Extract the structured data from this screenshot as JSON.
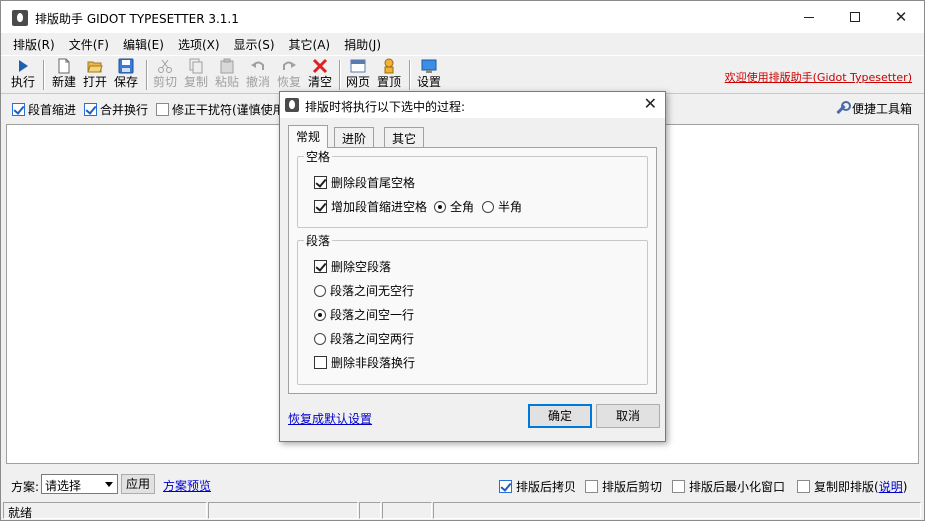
{
  "window": {
    "title": "排版助手 GIDOT TYPESETTER 3.1.1"
  },
  "menu": [
    "排版(R)",
    "文件(F)",
    "编辑(E)",
    "选项(X)",
    "显示(S)",
    "其它(A)",
    "捐助(J)"
  ],
  "toolbar": {
    "run": "执行",
    "new": "新建",
    "open": "打开",
    "save": "保存",
    "cut": "剪切",
    "copy": "复制",
    "paste": "粘贴",
    "undo": "撤消",
    "redo": "恢复",
    "clear": "清空",
    "web": "网页",
    "top": "置顶",
    "settings": "设置",
    "welcome": "欢迎使用排版助手(Gidot Typesetter)"
  },
  "options": {
    "indent": {
      "label": "段首缩进",
      "checked": true
    },
    "merge_lines": {
      "label": "合并换行",
      "checked": true
    },
    "fix_interference": {
      "label": "修正干扰符(谨慎使用",
      "checked": false
    },
    "toolbox": "便捷工具箱"
  },
  "bottom": {
    "scheme_label": "方案:",
    "scheme_value": "请选择",
    "apply": "应用",
    "preview": "方案预览",
    "copy_after": {
      "label": "排版后拷贝",
      "checked": true
    },
    "cut_after": {
      "label": "排版后剪切",
      "checked": false
    },
    "minimize_after": {
      "label": "排版后最小化窗口",
      "checked": false
    },
    "copy_to_typeset": {
      "label": "复制即排版(",
      "checked": false
    },
    "explain": "说明",
    "paren_close": ")"
  },
  "status": {
    "text": "就绪"
  },
  "dialog": {
    "title": "排版时将执行以下选中的过程:",
    "tabs": [
      "常规",
      "进阶",
      "其它"
    ],
    "group_space": {
      "label": "空格",
      "remove_trailing": {
        "label": "删除段首尾空格",
        "checked": true
      },
      "add_indent": {
        "label": "增加段首缩进空格",
        "checked": true
      },
      "full_width": {
        "label": "全角",
        "checked": true
      },
      "half_width": {
        "label": "半角",
        "checked": false
      }
    },
    "group_paragraph": {
      "label": "段落",
      "remove_empty": {
        "label": "删除空段落",
        "checked": true
      },
      "no_blank": {
        "label": "段落之间无空行",
        "checked": false
      },
      "one_blank": {
        "label": "段落之间空一行",
        "checked": true
      },
      "two_blank": {
        "label": "段落之间空两行",
        "checked": false
      },
      "remove_non_para": {
        "label": "删除非段落换行",
        "checked": false
      }
    },
    "restore_defaults": "恢复成默认设置",
    "ok": "确定",
    "cancel": "取消"
  }
}
